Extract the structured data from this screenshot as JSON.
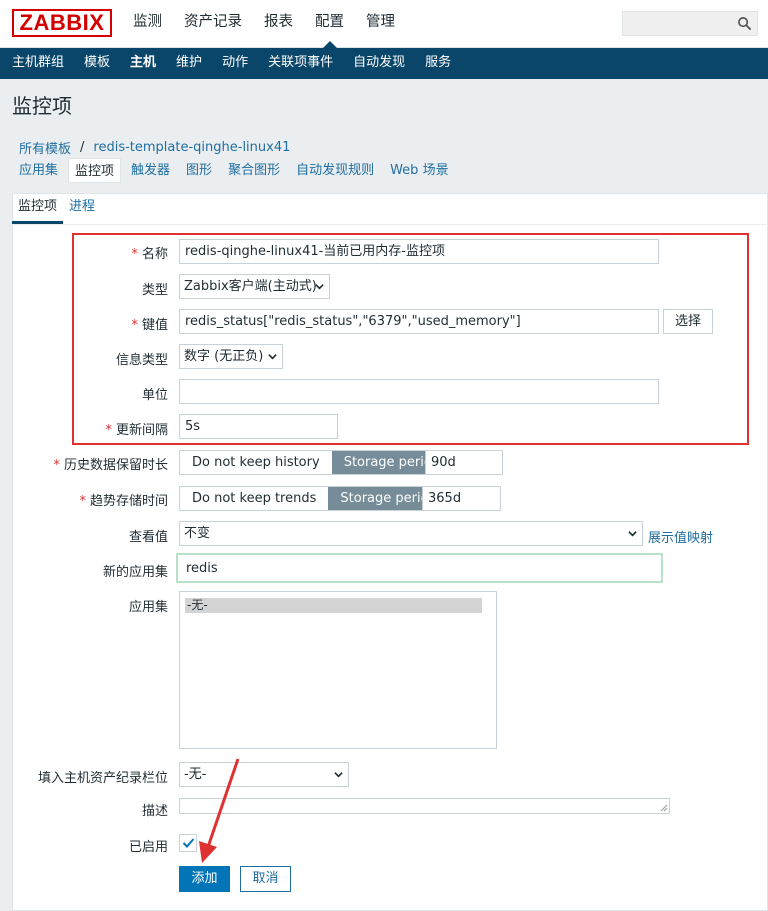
{
  "colors": {
    "brand": "#d40000",
    "nav": "#0a466a",
    "link": "#1f6ea1",
    "primary": "#0275b8",
    "highlight": "#e03131"
  },
  "logo": "ZABBIX",
  "top_menu": [
    "监测",
    "资产记录",
    "报表",
    "配置",
    "管理"
  ],
  "sub_menu": [
    "主机群组",
    "模板",
    "主机",
    "维护",
    "动作",
    "关联项事件",
    "自动发现",
    "服务"
  ],
  "page_title": "监控项",
  "breadcrumb": {
    "root": "所有模板",
    "sep": "/",
    "template": "redis-template-qinghe-linux41"
  },
  "content_tabs": [
    "应用集",
    "监控项",
    "触发器",
    "图形",
    "聚合图形",
    "自动发现规则",
    "Web 场景"
  ],
  "form_tabs": [
    "监控项",
    "进程"
  ],
  "required_mark": "*",
  "form": {
    "name": {
      "label": "名称",
      "value": "redis-qinghe-linux41-当前已用内存-监控项"
    },
    "type": {
      "label": "类型",
      "value": "Zabbix客户端(主动式)"
    },
    "key": {
      "label": "键值",
      "value": "redis_status[\"redis_status\",\"6379\",\"used_memory\"]",
      "button": "选择"
    },
    "info_type": {
      "label": "信息类型",
      "value": "数字 (无正负)"
    },
    "units": {
      "label": "单位",
      "value": ""
    },
    "interval": {
      "label": "更新间隔",
      "value": "5s"
    },
    "history": {
      "label": "历史数据保留时长",
      "opt_off": "Do not keep history",
      "opt_on": "Storage period",
      "value": "90d"
    },
    "trends": {
      "label": "趋势存储时间",
      "opt_off": "Do not keep trends",
      "opt_on": "Storage period",
      "value": "365d"
    },
    "valuemap": {
      "label": "查看值",
      "value": "不变",
      "link": "展示值映射"
    },
    "new_app": {
      "label": "新的应用集",
      "value": "redis"
    },
    "apps": {
      "label": "应用集",
      "options": [
        "-无-"
      ]
    },
    "inventory": {
      "label": "填入主机资产纪录栏位",
      "value": "-无-"
    },
    "description": {
      "label": "描述",
      "value": ""
    },
    "enabled": {
      "label": "已启用",
      "checked": true
    },
    "add_button": "添加",
    "cancel_button": "取消"
  }
}
